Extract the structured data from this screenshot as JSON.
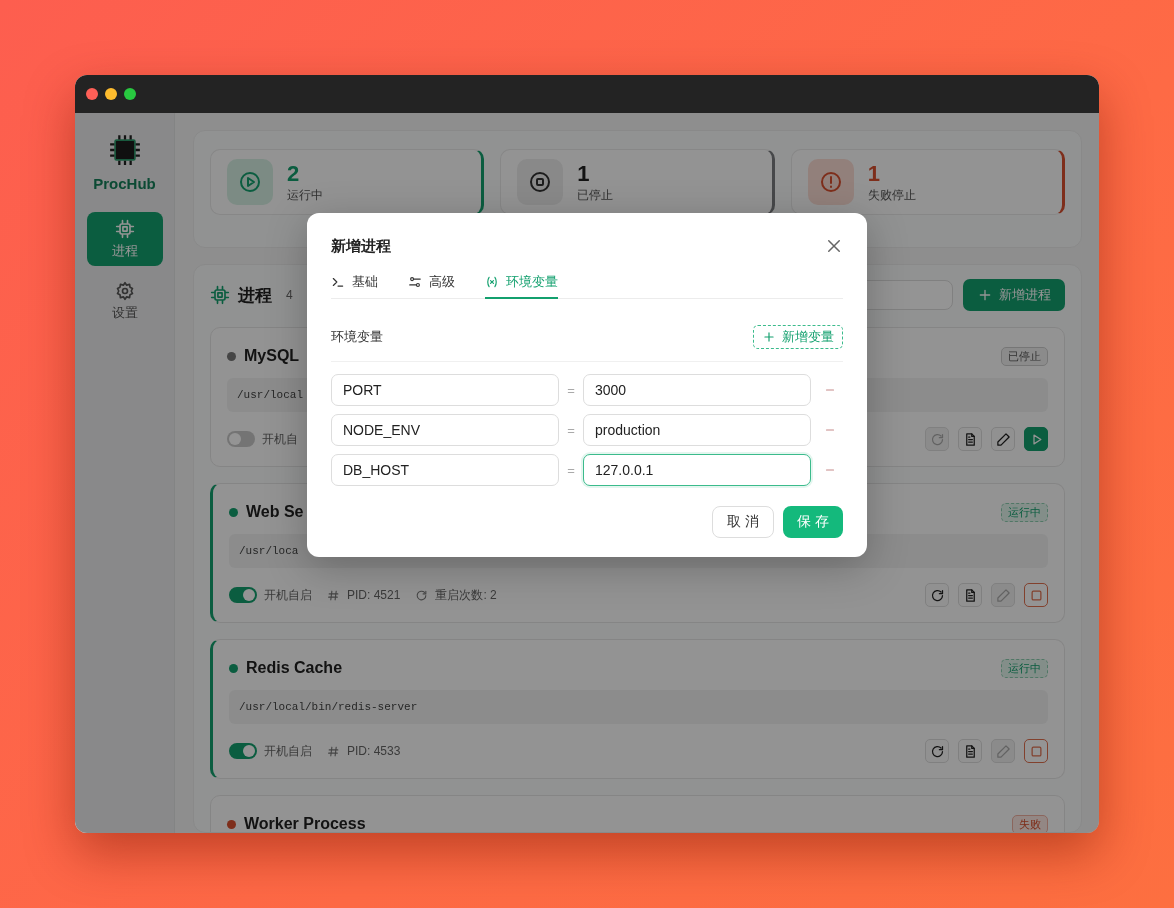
{
  "app": {
    "name": "ProcHub"
  },
  "sidebar": {
    "items": [
      {
        "label": "进程",
        "selected": true
      },
      {
        "label": "设置",
        "selected": false
      }
    ]
  },
  "stats": [
    {
      "kind": "running",
      "value": "2",
      "label": "运行中"
    },
    {
      "kind": "stopped",
      "value": "1",
      "label": "已停止"
    },
    {
      "kind": "failed",
      "value": "1",
      "label": "失败停止"
    }
  ],
  "section": {
    "title": "进程",
    "count": "4",
    "add_button": "新增进程"
  },
  "processes": [
    {
      "name": "MySQL",
      "kind": "stopped",
      "badge": "已停止",
      "command": "/usr/local",
      "autostart": false,
      "autostart_label": "开机自",
      "actions": [
        {
          "kind": "restart",
          "disabled": true
        },
        {
          "kind": "logs",
          "disabled": false
        },
        {
          "kind": "edit",
          "disabled": false
        },
        {
          "kind": "start",
          "disabled": false
        }
      ]
    },
    {
      "name": "Web Se",
      "kind": "running",
      "badge": "运行中",
      "command": "/usr/loca",
      "autostart": true,
      "autostart_label": "开机自启",
      "pid": "PID: 4521",
      "restarts": "重启次数: 2",
      "actions": [
        {
          "kind": "restart",
          "disabled": false
        },
        {
          "kind": "logs",
          "disabled": false
        },
        {
          "kind": "edit",
          "disabled": true
        },
        {
          "kind": "stop",
          "disabled": false
        }
      ]
    },
    {
      "name": "Redis Cache",
      "kind": "running",
      "badge": "运行中",
      "command": "/usr/local/bin/redis-server",
      "autostart": true,
      "autostart_label": "开机自启",
      "pid": "PID: 4533",
      "actions": [
        {
          "kind": "restart",
          "disabled": false
        },
        {
          "kind": "logs",
          "disabled": false
        },
        {
          "kind": "edit",
          "disabled": true
        },
        {
          "kind": "stop",
          "disabled": false
        }
      ]
    },
    {
      "name": "Worker Process",
      "kind": "failed",
      "badge": "失败"
    }
  ],
  "dialog": {
    "title": "新增进程",
    "tabs": [
      {
        "label": "基础",
        "selected": false
      },
      {
        "label": "高级",
        "selected": false
      },
      {
        "label": "环境变量",
        "selected": true
      }
    ],
    "section_label": "环境变量",
    "add_variable": "新增变量",
    "variables": [
      {
        "key": "PORT",
        "separator": "=",
        "value": "3000",
        "focused": false
      },
      {
        "key": "NODE_ENV",
        "separator": "=",
        "value": "production",
        "focused": false
      },
      {
        "key": "DB_HOST",
        "separator": "=",
        "value": "127.0.0.1",
        "focused": true
      }
    ],
    "buttons": [
      {
        "kind": "cancel",
        "label": "取 消"
      },
      {
        "kind": "save",
        "label": "保 存"
      }
    ]
  }
}
